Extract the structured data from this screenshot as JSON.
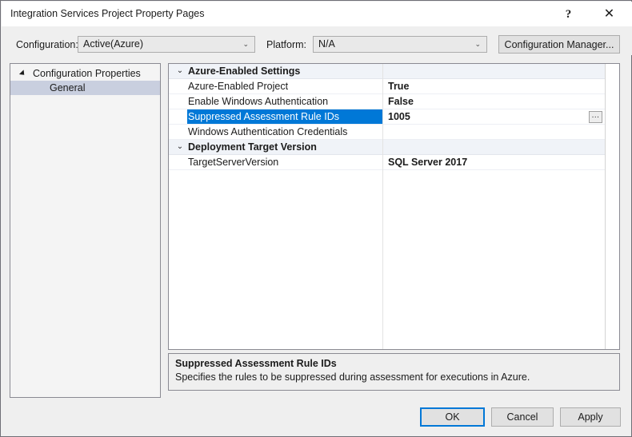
{
  "window": {
    "title": "Integration Services Project Property Pages",
    "help_icon": "?",
    "close_icon": "✕"
  },
  "toolbar": {
    "configuration_label": "Configuration:",
    "configuration_value": "Active(Azure)",
    "platform_label": "Platform:",
    "platform_value": "N/A",
    "configuration_manager_label": "Configuration Manager...",
    "dropdown_icon": "⌄"
  },
  "tree": {
    "root_label": "Configuration Properties",
    "children": [
      {
        "label": "General",
        "selected": true
      }
    ]
  },
  "grid": {
    "chevron_icon": "⌄",
    "ellipsis_label": "...",
    "groups": [
      {
        "name": "Azure-Enabled Settings",
        "rows": [
          {
            "name": "Azure-Enabled Project",
            "value": "True",
            "selected": false,
            "has_ellipsis": false
          },
          {
            "name": "Enable Windows Authentication",
            "value": "False",
            "selected": false,
            "has_ellipsis": false
          },
          {
            "name": "Suppressed Assessment Rule IDs",
            "value": "1005",
            "selected": true,
            "has_ellipsis": true
          },
          {
            "name": "Windows Authentication Credentials",
            "value": "",
            "selected": false,
            "has_ellipsis": false
          }
        ]
      },
      {
        "name": "Deployment Target Version",
        "rows": [
          {
            "name": "TargetServerVersion",
            "value": "SQL Server 2017",
            "selected": false,
            "has_ellipsis": false
          }
        ]
      }
    ]
  },
  "description": {
    "title": "Suppressed Assessment Rule IDs",
    "text": "Specifies the rules to be suppressed during assessment for executions in Azure."
  },
  "buttons": {
    "ok": "OK",
    "cancel": "Cancel",
    "apply": "Apply"
  },
  "colors": {
    "selection_blue": "#0078d7",
    "group_header_bg": "#f0f3f8",
    "tree_selection_bg": "#c9cfdf"
  }
}
